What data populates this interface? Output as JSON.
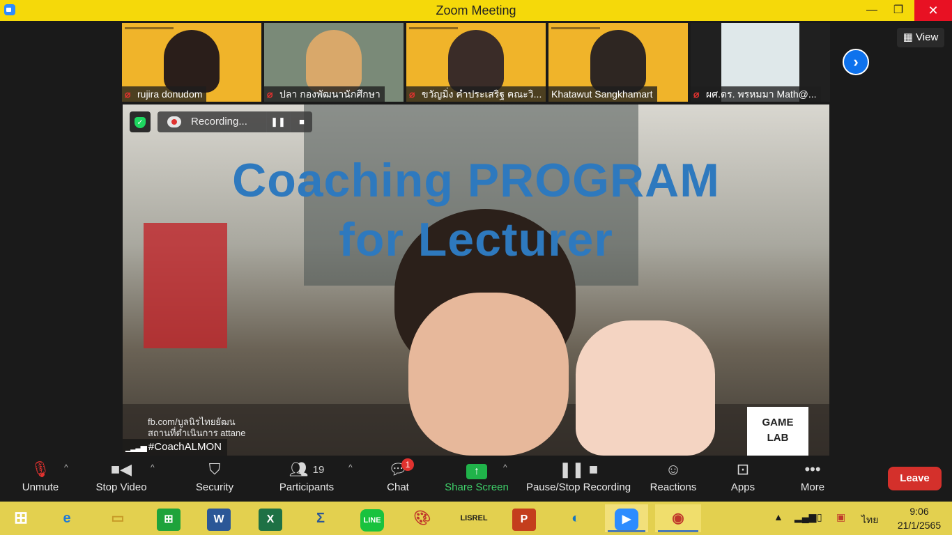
{
  "window": {
    "title": "Zoom Meeting"
  },
  "view_button": "View",
  "thumbnails": [
    {
      "name": "rujira donudom",
      "muted": true
    },
    {
      "name": "ปลา  กองพัฒนานักศึกษา",
      "muted": true
    },
    {
      "name": "ขวัญมิ่ง คำประเสริฐ คณะวิ...",
      "muted": true
    },
    {
      "name": "Khatawut Sangkhamart",
      "muted": false
    },
    {
      "name": "ผศ.ดร. พรหมมา Math@...",
      "muted": true
    }
  ],
  "main_video": {
    "headline_1": "Coaching PROGRAM",
    "headline_2": "for Lecturer",
    "credits_1": "fb.com/บูลนิรไทยยัฒน",
    "credits_2": "สถานที่ดำเนินการ attane",
    "speaker_tag": "#CoachALMON",
    "logo_text_1": "GAME",
    "logo_text_2": "LAB"
  },
  "recording": {
    "label": "Recording..."
  },
  "toolbar": {
    "unmute": "Unmute",
    "stop_video": "Stop Video",
    "security": "Security",
    "participants": "Participants",
    "participants_count": "19",
    "chat": "Chat",
    "chat_badge": "1",
    "share_screen": "Share Screen",
    "pause_stop_recording": "Pause/Stop Recording",
    "reactions": "Reactions",
    "apps": "Apps",
    "more": "More",
    "leave": "Leave"
  },
  "taskbar": {
    "lisrel": "LISREL",
    "language": "ไทย",
    "time": "9:06",
    "date": "21/1/2565"
  },
  "colors": {
    "titlebar": "#f5d90a",
    "taskbar": "#e3d04f",
    "leave": "#d4302b",
    "share_green": "#20b34a",
    "headline_blue": "#2e79be",
    "close_red": "#e81123"
  },
  "icons": [
    "zoom-app-icon",
    "minimize-icon",
    "maximize-icon",
    "close-icon",
    "mic-off-icon",
    "video-icon",
    "shield-icon",
    "participants-icon",
    "chat-icon",
    "share-icon",
    "pause-icon",
    "stop-icon",
    "reactions-icon",
    "apps-icon",
    "more-icon",
    "chevron-right-icon"
  ]
}
